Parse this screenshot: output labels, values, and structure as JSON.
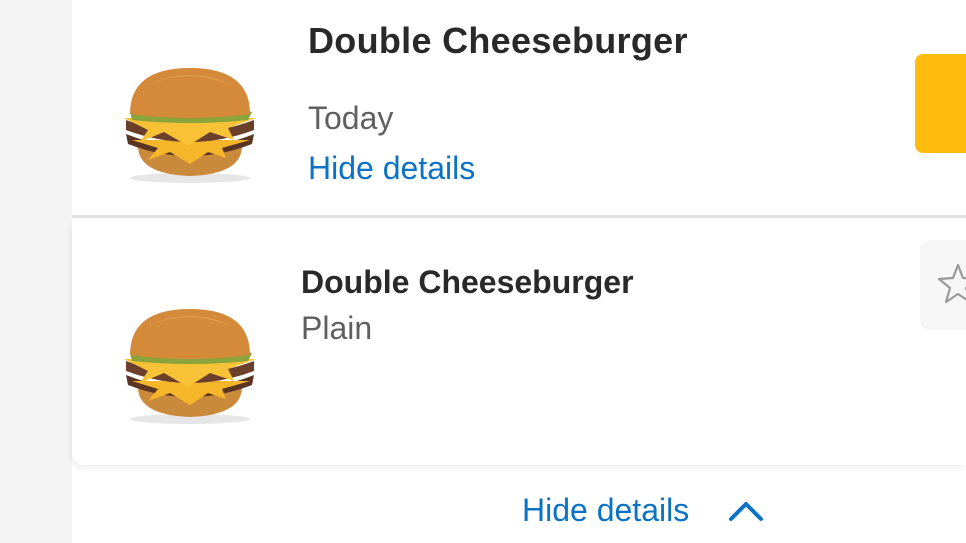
{
  "items": [
    {
      "title": "Double Cheeseburger",
      "subtitle": "Today",
      "link": "Hide details",
      "image": "double-cheeseburger-image"
    },
    {
      "title": "Double Cheeseburger",
      "subtitle": "Plain",
      "image": "double-cheeseburger-image",
      "favorite_icon": "star-outline-icon"
    }
  ],
  "footer": {
    "toggle_label": "Hide details",
    "toggle_icon": "chevron-up-icon"
  },
  "colors": {
    "link": "#0a73c6",
    "accent": "#ffbc0d",
    "title": "#292929",
    "subtitle": "#5f5f5f"
  }
}
